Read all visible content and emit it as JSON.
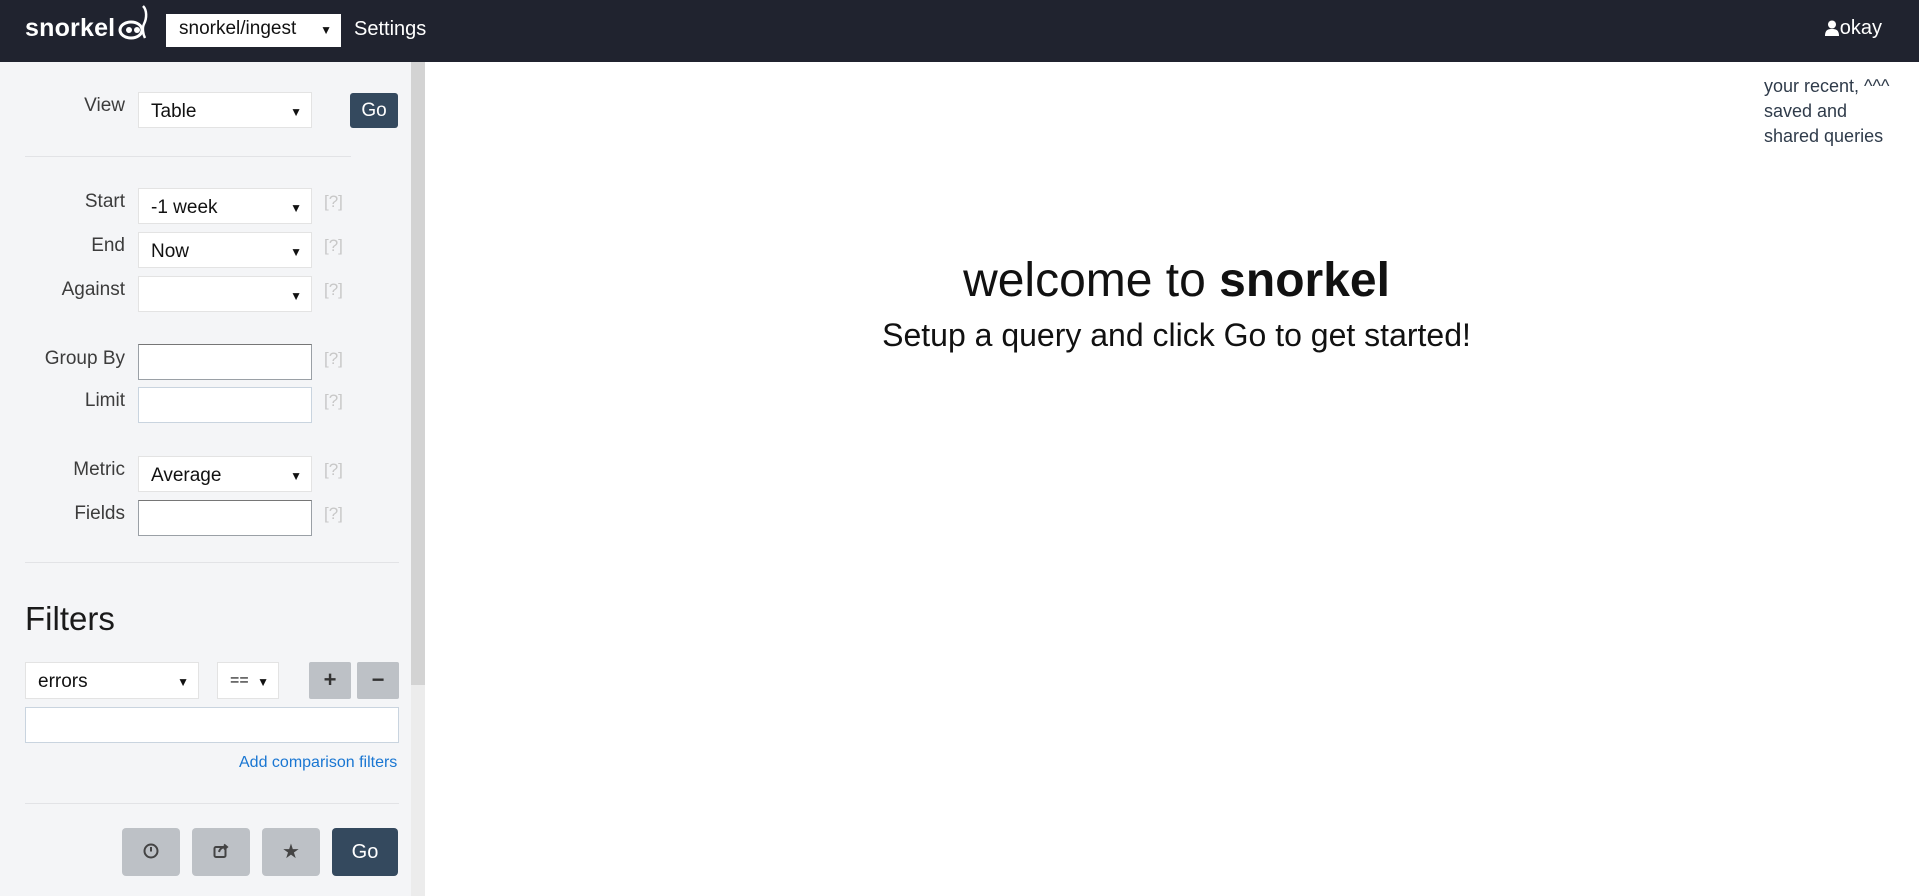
{
  "header": {
    "brand": "snorkel",
    "dataset": "snorkel/ingest",
    "settings_label": "Settings",
    "user": "okay"
  },
  "sidebar": {
    "view": {
      "label": "View",
      "value": "Table",
      "go_label": "Go"
    },
    "start": {
      "label": "Start",
      "value": "-1 week",
      "help": "[?]"
    },
    "end": {
      "label": "End",
      "value": "Now",
      "help": "[?]"
    },
    "against": {
      "label": "Against",
      "value": "",
      "help": "[?]"
    },
    "group_by": {
      "label": "Group By",
      "value": "",
      "help": "[?]"
    },
    "limit": {
      "label": "Limit",
      "value": "",
      "help": "[?]"
    },
    "metric": {
      "label": "Metric",
      "value": "Average",
      "help": "[?]"
    },
    "fields": {
      "label": "Fields",
      "value": "",
      "help": "[?]"
    },
    "filters": {
      "title": "Filters",
      "field": "errors",
      "operator": "==",
      "add_label": "+",
      "remove_label": "−",
      "value": "",
      "add_comparison": "Add comparison filters"
    },
    "actions": {
      "history_icon": "clock-icon",
      "share_icon": "share-icon",
      "save_icon": "star-icon",
      "go_label": "Go"
    }
  },
  "main": {
    "recent_note": "your recent, ^^^ saved and shared queries",
    "welcome_prefix": "welcome to",
    "welcome_brand": "snorkel",
    "subtitle": "Setup a query and click Go to get started!"
  }
}
